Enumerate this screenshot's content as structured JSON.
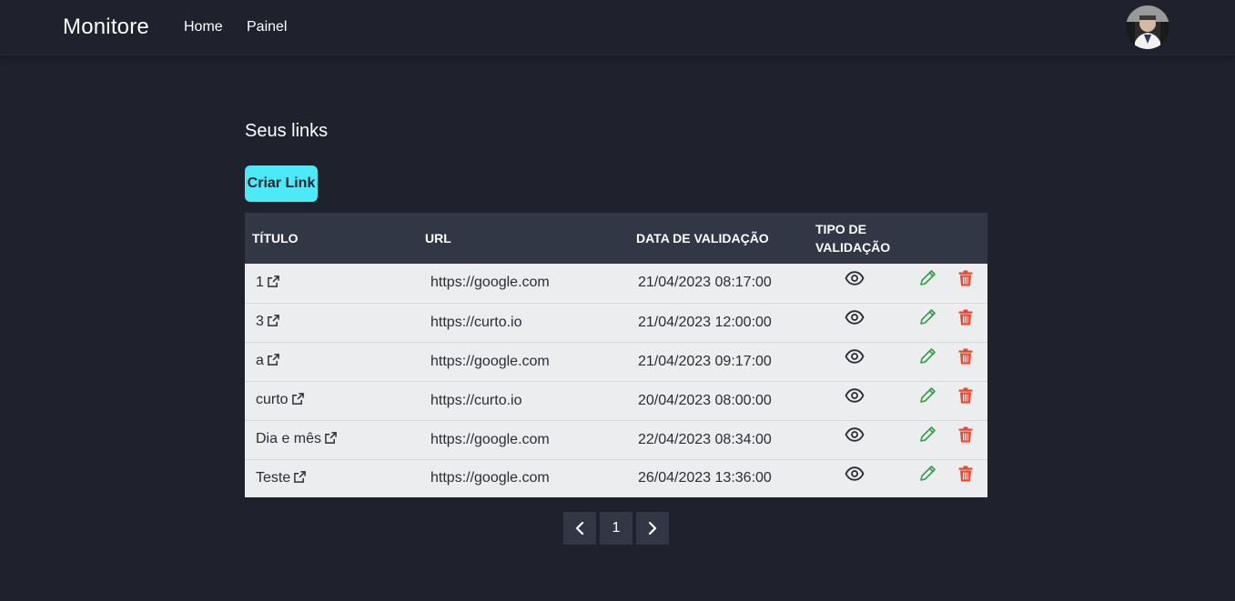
{
  "app": {
    "brand": "Monitore",
    "nav": [
      {
        "label": "Home"
      },
      {
        "label": "Painel"
      }
    ]
  },
  "main": {
    "title": "Seus links",
    "create_button": "Criar Link"
  },
  "table": {
    "headers": {
      "title": "TÍTULO",
      "url": "URL",
      "date": "DATA DE VALIDAÇÃO",
      "type": "TIPO DE VALIDAÇÃO"
    },
    "rows": [
      {
        "title": "1",
        "url": "https://google.com",
        "date": "21/04/2023 08:17:00"
      },
      {
        "title": "3",
        "url": "https://curto.io",
        "date": "21/04/2023 12:00:00"
      },
      {
        "title": "a",
        "url": "https://google.com",
        "date": "21/04/2023 09:17:00"
      },
      {
        "title": "curto",
        "url": "https://curto.io",
        "date": "20/04/2023 08:00:00"
      },
      {
        "title": "Dia e mês",
        "url": "https://google.com",
        "date": "22/04/2023 08:34:00"
      },
      {
        "title": "Teste",
        "url": "https://google.com",
        "date": "26/04/2023 13:36:00"
      }
    ]
  },
  "pagination": {
    "current_page": "1"
  },
  "colors": {
    "background": "#1f212c",
    "accent": "#4ce9f7",
    "header_bg": "#323745",
    "row_bg": "#ecedef",
    "edit": "#2e9e43",
    "delete": "#e8492e"
  },
  "icons": {
    "external_link": "external-link-icon",
    "view": "eye-icon",
    "edit": "pencil-icon",
    "delete": "trash-icon",
    "prev": "chevron-left-icon",
    "next": "chevron-right-icon"
  }
}
